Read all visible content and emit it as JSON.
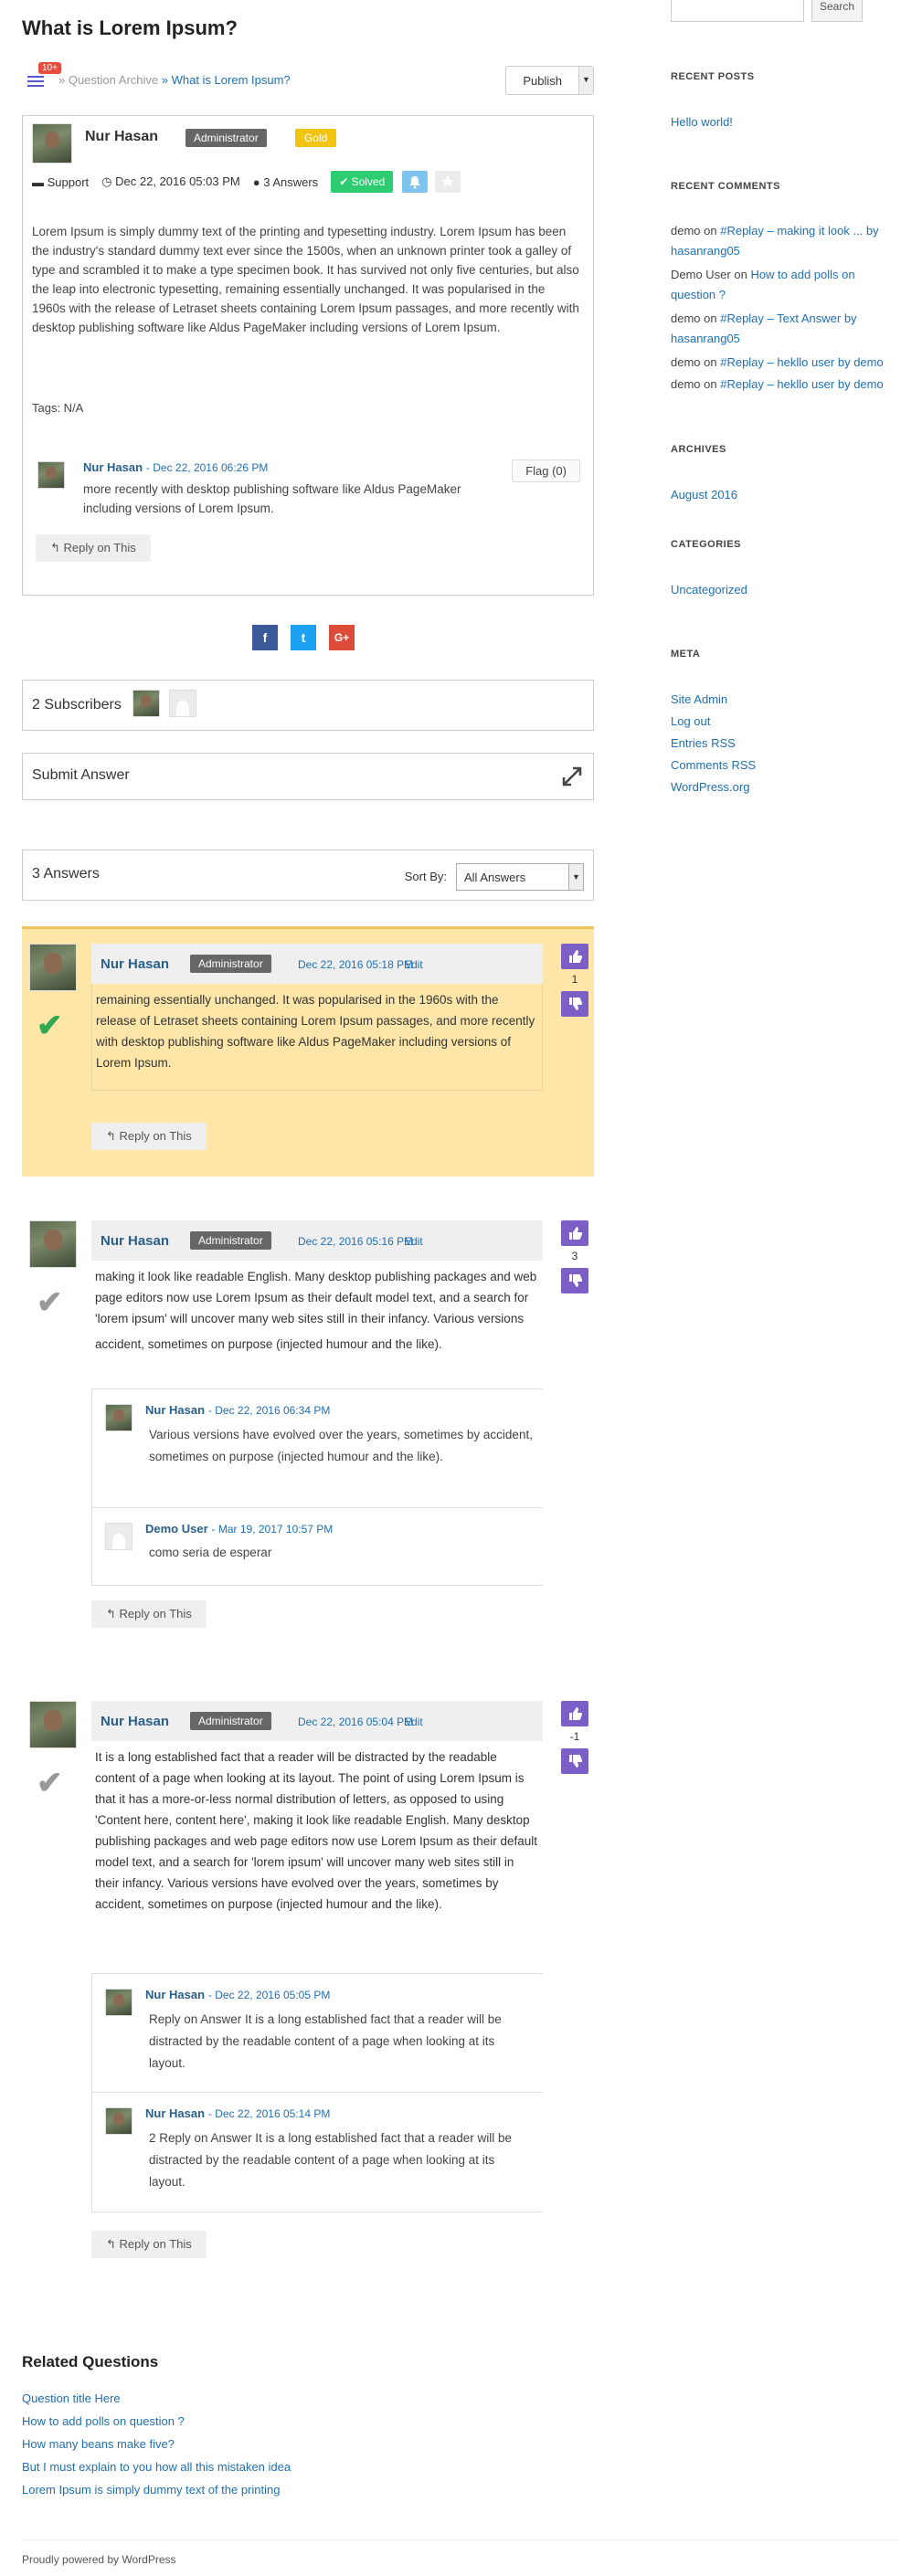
{
  "question": {
    "title": "What is Lorem Ipsum?",
    "notif_count": "10+",
    "breadcrumb_archive": "» Question Archive",
    "breadcrumb_current": "» What is Lorem Ipsum?",
    "publish_label": "Publish",
    "author": "Nur Hasan",
    "role": "Administrator",
    "badge": "Gold",
    "category": "Support",
    "date": "Dec 22, 2016 05:03 PM",
    "answers_count": "3 Answers",
    "solved_label": "Solved",
    "body": "Lorem Ipsum is simply dummy text of the printing and typesetting industry. Lorem Ipsum has been the industry's standard dummy text ever since the 1500s, when an unknown printer took a galley of type and scrambled it to make a type specimen book. It has survived not only five centuries, but also the leap into electronic typesetting, remaining essentially unchanged. It was popularised in the 1960s with the release of Letraset sheets containing Lorem Ipsum passages, and more recently with desktop publishing software like Aldus PageMaker including versions of Lorem Ipsum.",
    "tags": "Tags: N/A",
    "comment": {
      "author": "Nur Hasan",
      "date": "- Dec 22, 2016 06:26 PM",
      "text": "more recently with desktop publishing software like Aldus PageMaker including versions of Lorem Ipsum."
    },
    "flag_label": "Flag (0)",
    "reply_label": "Reply on This"
  },
  "share": {
    "facebook": "f",
    "twitter": "t",
    "google": "G+"
  },
  "subscribers_label": "2 Subscribers",
  "submit_answer_label": "Submit Answer",
  "answers_header": {
    "count_label": "3 Answers",
    "sort_label": "Sort By:",
    "sort_value": "All Answers"
  },
  "answers": [
    {
      "author": "Nur Hasan",
      "role": "Administrator",
      "date": "Dec 22, 2016 05:18 PM",
      "edit": "Edit",
      "votes": "1",
      "body": "remaining essentially unchanged. It was popularised in the 1960s with the release of Letraset sheets containing Lorem Ipsum passages, and more recently with desktop publishing software like Aldus PageMaker including versions of Lorem Ipsum.",
      "reply_label": "Reply on This"
    },
    {
      "author": "Nur Hasan",
      "role": "Administrator",
      "date": "Dec 22, 2016 05:16 PM",
      "edit": "Edit",
      "votes": "3",
      "body": "making it look like readable English. Many desktop publishing packages and web page editors now use Lorem Ipsum as their default model text, and a search for 'lorem ipsum' will uncover many web sites still in their infancy. Various versions have evolved over the years, sometimes by",
      "body_tail": "accident, sometimes on purpose (injected humour and the like).",
      "comments": [
        {
          "author": "Nur Hasan",
          "date": "- Dec 22, 2016 06:34 PM",
          "text": "Various versions have evolved over the years, sometimes by accident, sometimes on purpose (injected humour and the like)."
        },
        {
          "author": "Demo User",
          "date": "- Mar 19, 2017 10:57 PM",
          "text": "como seria de esperar"
        }
      ],
      "reply_label": "Reply on This"
    },
    {
      "author": "Nur Hasan",
      "role": "Administrator",
      "date": "Dec 22, 2016 05:04 PM",
      "edit": "Edit",
      "votes": "-1",
      "body": "It is a long established fact that a reader will be distracted by the readable content of a page when looking at its layout. The point of using Lorem Ipsum is that it has a more-or-less normal distribution of letters, as opposed to using 'Content here, content here', making it look like readable English. Many desktop publishing packages and web page editors now use Lorem Ipsum as their default model text, and a search for 'lorem ipsum' will uncover many web sites still in their infancy. Various versions have evolved over the years, sometimes by accident, sometimes on purpose (injected humour and the like).",
      "comments": [
        {
          "author": "Nur Hasan",
          "date": "- Dec 22, 2016 05:05 PM",
          "text": "Reply on Answer It is a long established fact that a reader will be distracted by the readable content of a page when looking at its layout."
        },
        {
          "author": "Nur Hasan",
          "date": "- Dec 22, 2016 05:14 PM",
          "text": "2 Reply on Answer It is a long established fact that a reader will be distracted by the readable content of a page when looking at its layout."
        }
      ],
      "reply_label": "Reply on This"
    }
  ],
  "related": {
    "title": "Related Questions",
    "items": [
      "Question title Here",
      "How to add polls on question ?",
      "How many beans make five?",
      "But I must explain to you how all this mistaken idea",
      "Lorem Ipsum is simply dummy text of the printing"
    ]
  },
  "sidebar": {
    "search_button": "Search",
    "recent_posts_title": "RECENT POSTS",
    "recent_posts": [
      "Hello world!"
    ],
    "recent_comments_title": "RECENT COMMENTS",
    "recent_comments": [
      {
        "who": "demo",
        "on": " on ",
        "what": "#Replay – making it look ... by hasanrang05"
      },
      {
        "who": "Demo User",
        "on": " on ",
        "what": "How to add polls on question ?"
      },
      {
        "who": "demo",
        "on": " on ",
        "what": "#Replay – Text Answer by hasanrang05"
      },
      {
        "who": "demo",
        "on": " on ",
        "what": "#Replay – hekllo user by demo"
      },
      {
        "who": "demo",
        "on": " on ",
        "what": "#Replay – hekllo user by demo"
      }
    ],
    "archives_title": "ARCHIVES",
    "archives": [
      "August 2016"
    ],
    "categories_title": "CATEGORIES",
    "categories": [
      "Uncategorized"
    ],
    "meta_title": "META",
    "meta": [
      "Site Admin",
      "Log out",
      "Entries RSS",
      "Comments RSS",
      "WordPress.org"
    ]
  },
  "footer": "Proudly powered by WordPress"
}
